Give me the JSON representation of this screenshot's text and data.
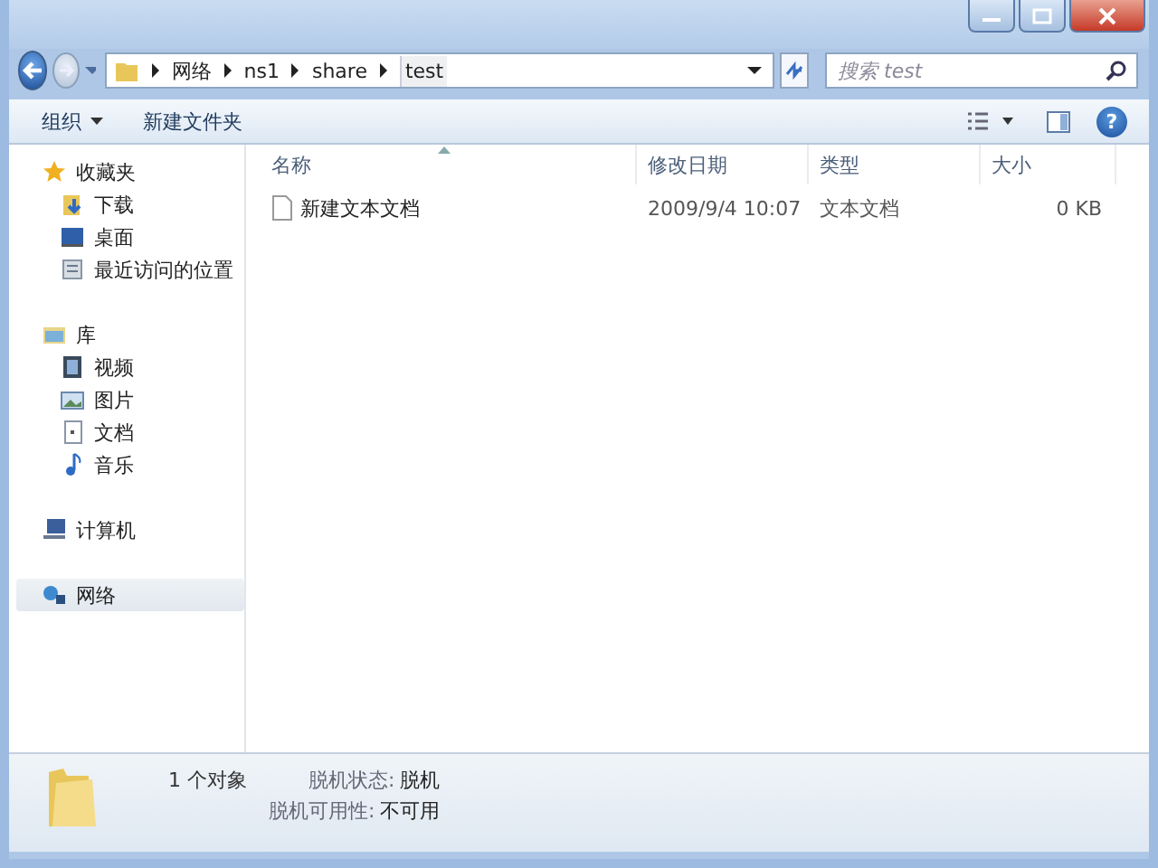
{
  "address": {
    "crumbs": [
      "网络",
      "ns1",
      "share",
      "test"
    ]
  },
  "search": {
    "placeholder": "搜索 test"
  },
  "toolbar": {
    "buttons": [
      {
        "label": "组织",
        "dropdown": true
      },
      {
        "label": "新建文件夹",
        "dropdown": false
      }
    ],
    "help": "?"
  },
  "sidebar": {
    "groups": [
      {
        "label": "收藏夹",
        "kind": "star",
        "selected": false,
        "children": [
          {
            "label": "下载",
            "kind": "download",
            "selected": false
          },
          {
            "label": "桌面",
            "kind": "desktop",
            "selected": false
          },
          {
            "label": "最近访问的位置",
            "kind": "recent",
            "selected": false
          }
        ]
      },
      {
        "label": "库",
        "kind": "library",
        "selected": false,
        "children": [
          {
            "label": "视频",
            "kind": "video",
            "selected": false
          },
          {
            "label": "图片",
            "kind": "picture",
            "selected": false
          },
          {
            "label": "文档",
            "kind": "document",
            "selected": false
          },
          {
            "label": "音乐",
            "kind": "music",
            "selected": false
          }
        ]
      },
      {
        "label": "计算机",
        "kind": "computer",
        "selected": false
      },
      {
        "label": "网络",
        "kind": "network",
        "selected": true
      }
    ]
  },
  "table": {
    "columns": [
      {
        "label": "名称",
        "sorted": true
      },
      {
        "label": "修改日期",
        "sorted": false
      },
      {
        "label": "类型",
        "sorted": false
      },
      {
        "label": "大小",
        "sorted": false
      }
    ],
    "rows": [
      {
        "cells": [
          "新建文本文档",
          "2009/9/4 10:07",
          "文本文档",
          "0 KB"
        ]
      }
    ]
  },
  "status_bar": {
    "count": "1 个对象",
    "fields": [
      {
        "label": "脱机状态:",
        "value": "脱机"
      },
      {
        "label": "脱机可用性:",
        "value": "不可用"
      }
    ]
  }
}
